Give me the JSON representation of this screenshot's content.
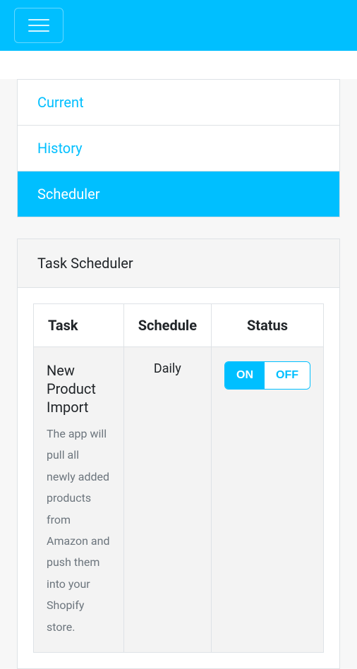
{
  "nav_tabs": {
    "current": "Current",
    "history": "History",
    "scheduler": "Scheduler"
  },
  "card": {
    "title": "Task Scheduler"
  },
  "table": {
    "headers": {
      "task": "Task",
      "schedule": "Schedule",
      "status": "Status"
    },
    "row": {
      "task_title": "New Product Import",
      "task_desc": "The app will pull all newly added products from Amazon and push them into your Shopify store.",
      "schedule": "Daily",
      "toggle_on": "ON",
      "toggle_off": "OFF"
    }
  }
}
